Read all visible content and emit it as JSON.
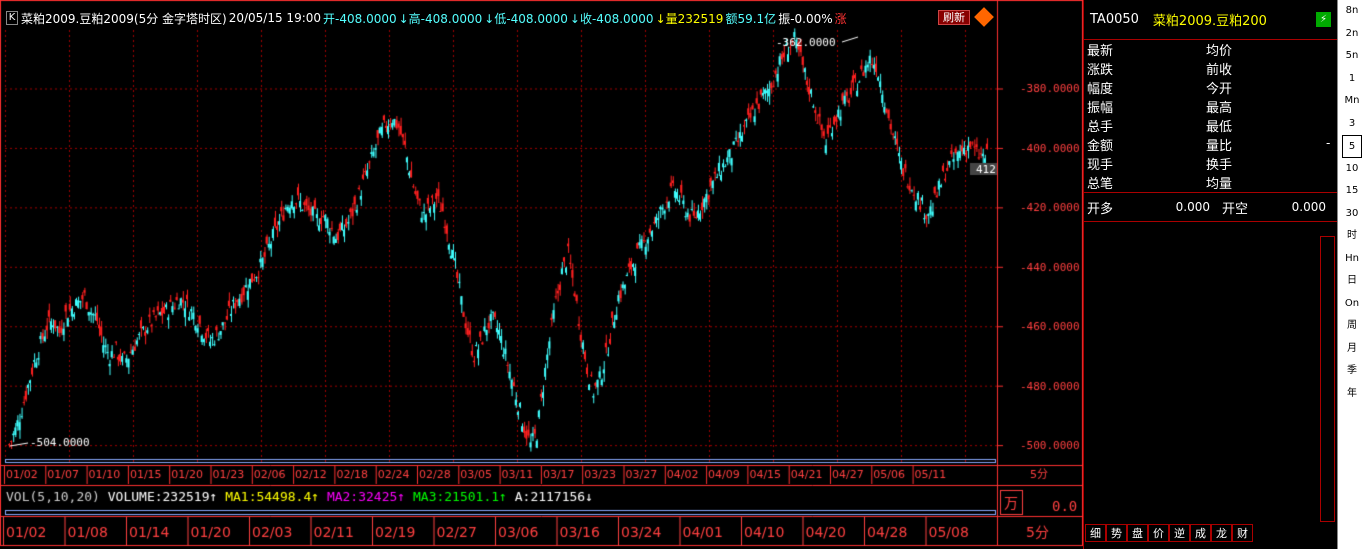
{
  "header": {
    "k_icon": "K",
    "title": "菜粕2009.豆粕2009(5分 金字塔时区)",
    "datetime": "20/05/15 19:00",
    "open": "开-408.0000",
    "high": "↓高-408.0000",
    "low": "↓低-408.0000",
    "close": "↓收-408.0000",
    "volume": "↓量232519",
    "amount": "额59.1亿",
    "amplitude": "振-0.00%",
    "zhang": "涨",
    "refresh_label": "刷新"
  },
  "price_axis": [
    "-380.0000",
    "-400.0000",
    "-420.0000",
    "-440.0000",
    "-460.0000",
    "-480.0000",
    "-500.0000"
  ],
  "high_label": "-362.0000",
  "low_label": "-504.0000",
  "last_tag": "412",
  "time_axis_upper": [
    "01/02",
    "01/07",
    "01/10",
    "01/15",
    "01/20",
    "01/23",
    "02/06",
    "02/12",
    "02/18",
    "02/24",
    "02/28",
    "03/05",
    "03/11",
    "03/17",
    "03/23",
    "03/27",
    "04/02",
    "04/09",
    "04/15",
    "04/21",
    "04/27",
    "05/06",
    "05/11"
  ],
  "period_upper": "5分",
  "vol": {
    "label": "VOL(5,10,20)",
    "volume": "VOLUME:232519",
    "ma1": "MA1:54498.4",
    "ma2": "MA2:32425",
    "ma3": "MA3:21501.1",
    "a": "A:2117156"
  },
  "wan_label": "万",
  "zero_value": "0.0",
  "time_axis_lower": [
    "01/02",
    "01/08",
    "01/14",
    "01/20",
    "02/03",
    "02/11",
    "02/19",
    "02/27",
    "03/06",
    "03/16",
    "03/24",
    "04/01",
    "04/10",
    "04/20",
    "04/28",
    "05/08"
  ],
  "period_lower": "5分",
  "right_panel": {
    "code": "TA0050",
    "name": "菜粕2009.豆粕200",
    "rows": [
      [
        "最新",
        "均价"
      ],
      [
        "涨跌",
        "前收"
      ],
      [
        "幅度",
        "今开"
      ],
      [
        "振幅",
        "最高"
      ],
      [
        "总手",
        "最低"
      ],
      [
        "金额",
        "量比"
      ],
      [
        "现手",
        "换手"
      ],
      [
        "总笔",
        "均量"
      ]
    ],
    "kaiduo": "开多",
    "kaiduo_val": "0.000",
    "kaikong": "开空",
    "kaikong_val": "0.000",
    "dash": "-",
    "tabs": [
      "细",
      "势",
      "盘",
      "价",
      "逆",
      "成",
      "龙",
      "财"
    ]
  },
  "sidebar": [
    "8n",
    "2n",
    "5n",
    "1",
    "Mn",
    "3",
    "5",
    "10",
    "15",
    "30",
    "时",
    "Hn",
    "日",
    "On",
    "周",
    "月",
    "季",
    "年"
  ],
  "colors": {
    "up": "#ff2020",
    "down": "#40ffff",
    "grid": "#a00000",
    "axis": "#ff3030"
  },
  "chart_data": {
    "type": "candlestick",
    "ylim": [
      -504,
      -362
    ],
    "series": [
      {
        "values": [
          -500,
          -495,
          -488,
          -480,
          -472,
          -466,
          -460,
          -458,
          -462,
          -456,
          -454,
          -452,
          -450,
          -455,
          -458,
          -466,
          -470,
          -468,
          -472,
          -470,
          -466,
          -463,
          -460,
          -458,
          -456,
          -455,
          -453,
          -451,
          -452,
          -455,
          -458,
          -462,
          -465,
          -463,
          -460,
          -456,
          -452,
          -449,
          -446,
          -443,
          -440,
          -435,
          -430,
          -425,
          -420,
          -417,
          -418,
          -420,
          -422,
          -424,
          -423,
          -426,
          -430,
          -428,
          -425,
          -420,
          -414,
          -408,
          -402,
          -396,
          -392,
          -390,
          -393,
          -400,
          -410,
          -418,
          -423,
          -420,
          -417,
          -421,
          -430,
          -440,
          -452,
          -462,
          -470,
          -466,
          -460,
          -458,
          -462,
          -470,
          -478,
          -486,
          -494,
          -500,
          -496,
          -480,
          -465,
          -452,
          -442,
          -436,
          -448,
          -462,
          -474,
          -482,
          -478,
          -470,
          -460,
          -450,
          -446,
          -440,
          -436,
          -432,
          -428,
          -425,
          -420,
          -416,
          -414,
          -418,
          -422,
          -424,
          -420,
          -416,
          -412,
          -408,
          -405,
          -402,
          -398,
          -394,
          -390,
          -386,
          -383,
          -380,
          -375,
          -370,
          -366,
          -364,
          -370,
          -378,
          -384,
          -392,
          -398,
          -392,
          -388,
          -385,
          -382,
          -378,
          -374,
          -370,
          -372,
          -380,
          -390,
          -398,
          -406,
          -410,
          -414,
          -418,
          -422,
          -420,
          -414,
          -408,
          -405,
          -402,
          -400,
          -399,
          -402,
          -403
        ]
      }
    ]
  }
}
